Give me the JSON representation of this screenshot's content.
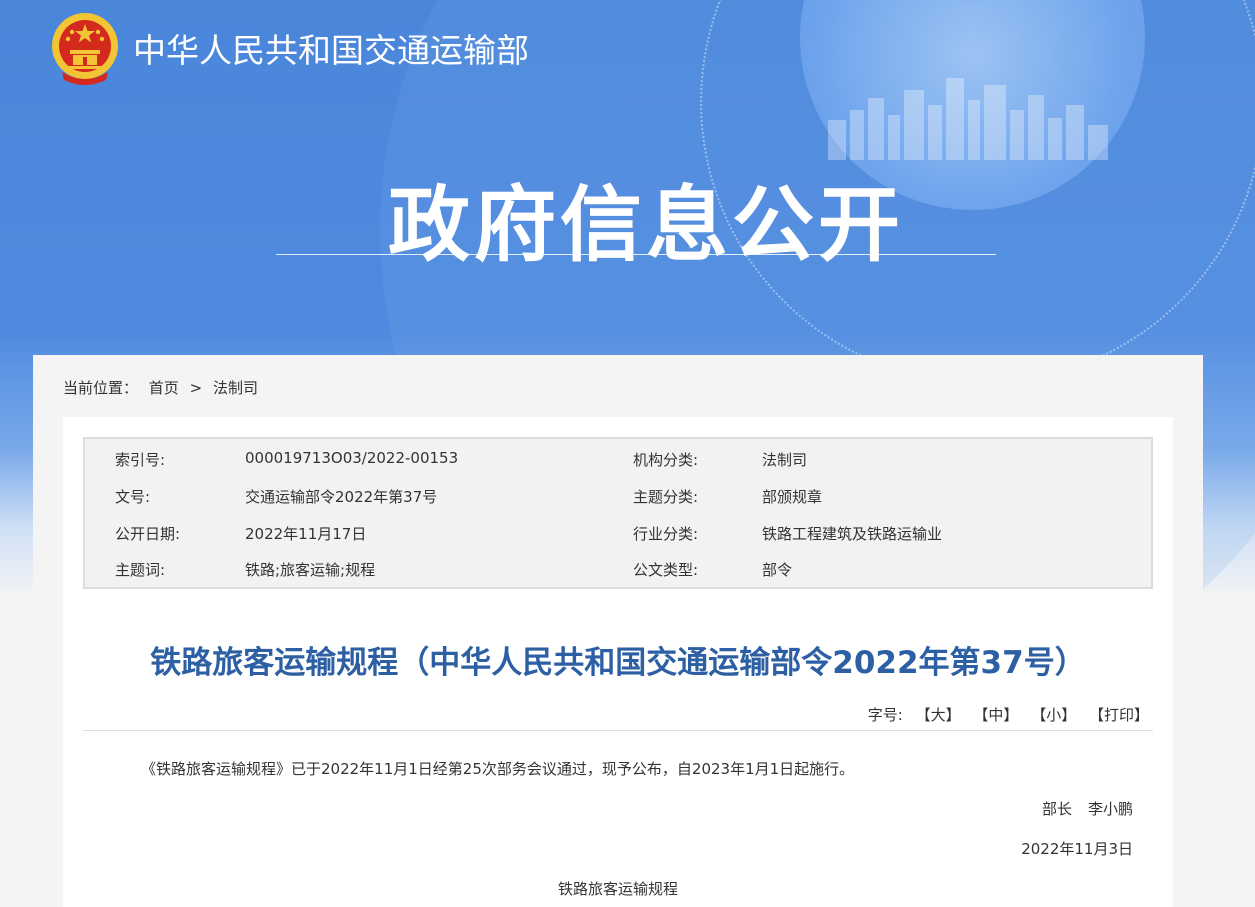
{
  "header": {
    "ministry_name": "中华人民共和国交通运输部",
    "section_title": "政府信息公开"
  },
  "breadcrumb": {
    "label": "当前位置：",
    "home": "首页",
    "separator": ">",
    "current": "法制司"
  },
  "meta": {
    "index_label": "索引号:",
    "index_value": "000019713O03/2022-00153",
    "doc_no_label": "文号:",
    "doc_no_value": "交通运输部令2022年第37号",
    "date_label": "公开日期:",
    "date_value": "2022年11月17日",
    "keywords_label": "主题词:",
    "keywords_value": "铁路;旅客运输;规程",
    "org_label": "机构分类:",
    "org_value": "法制司",
    "topic_label": "主题分类:",
    "topic_value": "部颁规章",
    "industry_label": "行业分类:",
    "industry_value": "铁路工程建筑及铁路运输业",
    "type_label": "公文类型:",
    "type_value": "部令"
  },
  "article": {
    "title": "铁路旅客运输规程（中华人民共和国交通运输部令2022年第37号）",
    "font_label": "字号:",
    "font_large": "【大】",
    "font_medium": "【中】",
    "font_small": "【小】",
    "print": "【打印】",
    "paragraph": "《铁路旅客运输规程》已于2022年11月1日经第25次部务会议通过，现予公布，自2023年1月1日起施行。",
    "signer_title": "部长",
    "signer_name": "李小鹏",
    "sign_date": "2022年11月3日",
    "subtitle": "铁路旅客运输规程"
  },
  "colors": {
    "banner_blue": "#4a86da",
    "title_blue": "#2c5fa3",
    "emblem_red": "#d42a1e",
    "emblem_gold": "#f3c433"
  }
}
